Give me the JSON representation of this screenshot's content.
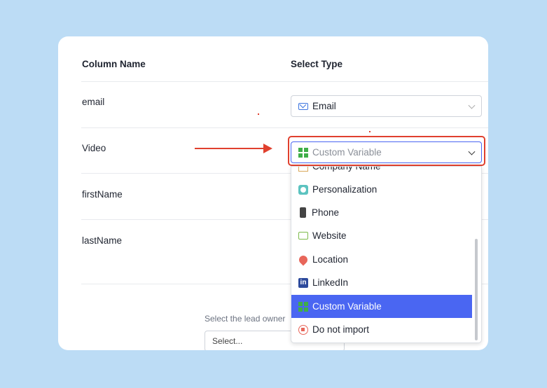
{
  "headers": {
    "column_name": "Column Name",
    "select_type": "Select Type"
  },
  "rows": [
    {
      "name": "email",
      "type": "Email",
      "type_icon": "envelope-icon"
    },
    {
      "name": "Video",
      "type": "Custom Variable",
      "type_icon": "grid-plus-icon"
    },
    {
      "name": "firstName"
    },
    {
      "name": "lastName"
    }
  ],
  "dropdown": {
    "items": [
      {
        "label": "Company Name",
        "icon": "building-icon"
      },
      {
        "label": "Personalization",
        "icon": "chat-icon"
      },
      {
        "label": "Phone",
        "icon": "phone-icon"
      },
      {
        "label": "Website",
        "icon": "web-icon"
      },
      {
        "label": "Location",
        "icon": "pin-icon"
      },
      {
        "label": "LinkedIn",
        "icon": "linkedin-icon"
      },
      {
        "label": "Custom Variable",
        "icon": "grid-plus-icon",
        "selected": true
      },
      {
        "label": "Do not import",
        "icon": "stop-icon"
      }
    ]
  },
  "lead_owner": {
    "label": "Select the lead owner",
    "placeholder": "Select..."
  },
  "colors": {
    "highlight": "#4a66f2",
    "annotation": "#e0402e",
    "background": "#bcdcf5"
  }
}
